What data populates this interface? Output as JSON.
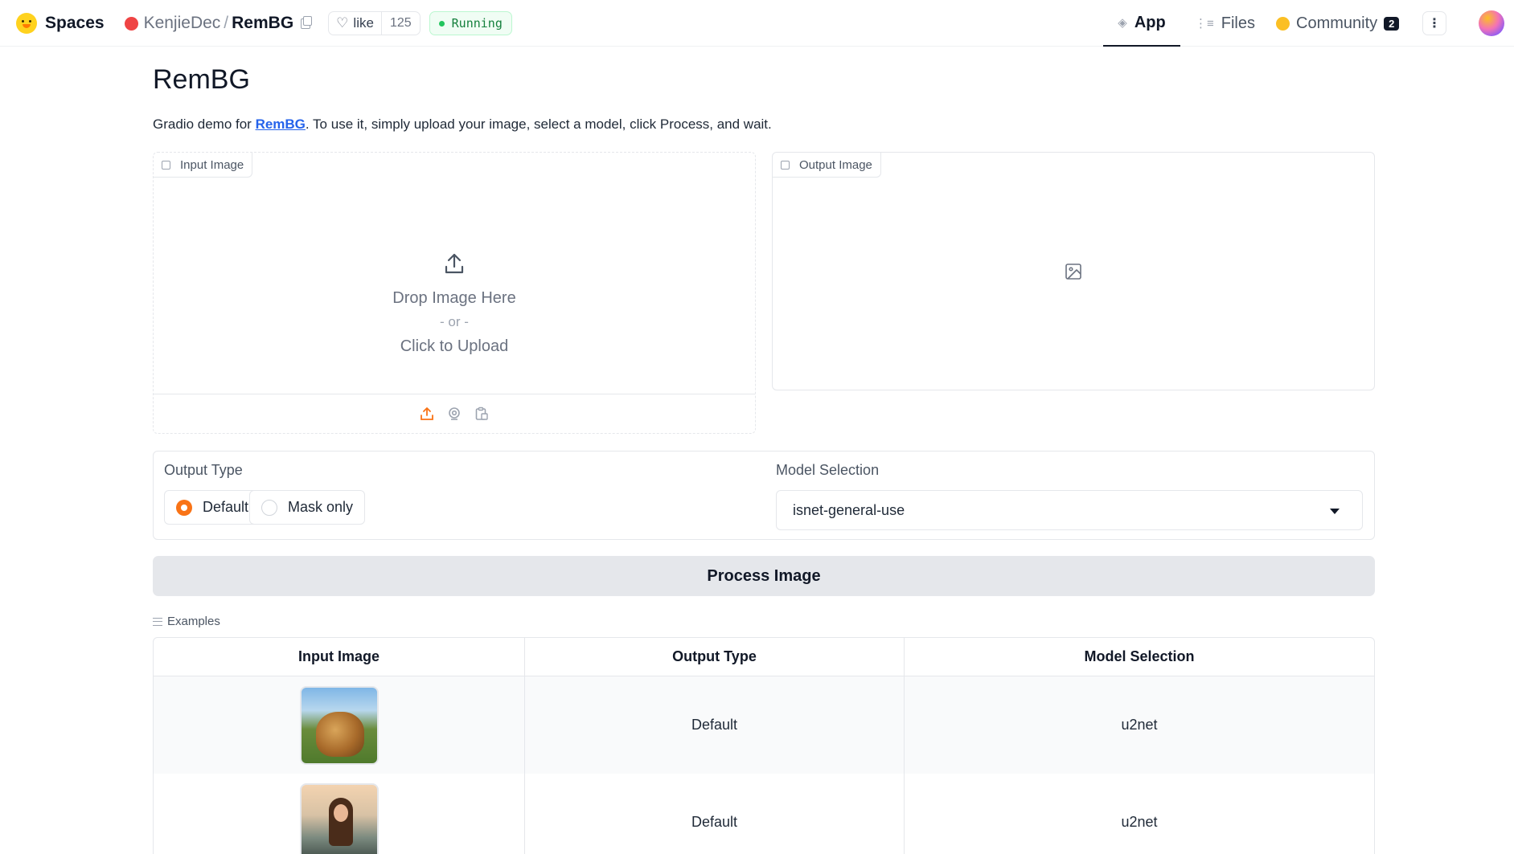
{
  "nav": {
    "brand": "Spaces",
    "owner": "KenjieDec",
    "separator": "/",
    "repo": "RemBG",
    "like_label": "like",
    "like_count": "125",
    "status": "Running",
    "tabs": [
      {
        "label": "App",
        "active": true
      },
      {
        "label": "Files",
        "active": false
      },
      {
        "label": "Community",
        "active": false,
        "badge": "2"
      }
    ],
    "kebab": "⋮"
  },
  "page": {
    "title": "RemBG",
    "desc_prefix": "Gradio demo for ",
    "desc_link": "RemBG",
    "desc_suffix": ". To use it, simply upload your image, select a model, click Process, and wait."
  },
  "input_image": {
    "label": "Input Image",
    "drop": "Drop Image Here",
    "or": "- or -",
    "click": "Click to Upload"
  },
  "output_image": {
    "label": "Output Image"
  },
  "controls": {
    "output_type_label": "Output Type",
    "options": [
      "Default",
      "Mask only"
    ],
    "selected_option": "Default",
    "model_label": "Model Selection",
    "model_value": "isnet-general-use"
  },
  "process_button": "Process Image",
  "examples": {
    "label": "Examples",
    "headers": [
      "Input Image",
      "Output Type",
      "Model Selection"
    ],
    "rows": [
      {
        "image": "lion-thumbnail",
        "output_type": "Default",
        "model": "u2net"
      },
      {
        "image": "girl-thumbnail",
        "output_type": "Default",
        "model": "u2net"
      }
    ]
  },
  "colors": {
    "accent": "#f97316",
    "link": "#2563eb",
    "status_green": "#15803d",
    "button_bg": "#e5e7eb"
  }
}
